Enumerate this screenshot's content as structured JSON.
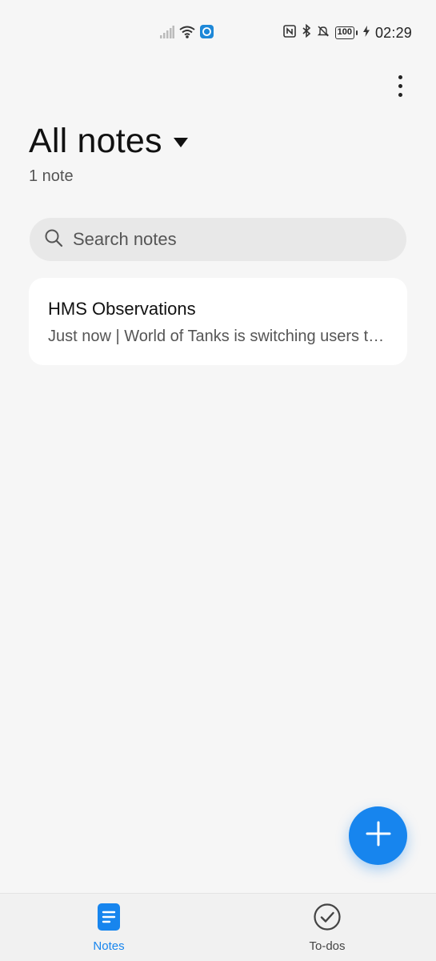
{
  "status_bar": {
    "time": "02:29",
    "battery": "100",
    "icons": [
      "signal-icon",
      "wifi-icon",
      "app-notification-icon",
      "nfc-icon",
      "bluetooth-icon",
      "mute-bell-icon",
      "battery-icon",
      "charging-icon"
    ]
  },
  "header": {
    "title": "All notes",
    "count": "1 note"
  },
  "search": {
    "placeholder": "Search notes",
    "value": ""
  },
  "notes": [
    {
      "title": "HMS Observations",
      "subtitle": "Just now | World of Tanks is switching users to HMS Core"
    }
  ],
  "bottom_nav": {
    "items": [
      {
        "label": "Notes",
        "icon": "notes-icon",
        "active": true
      },
      {
        "label": "To-dos",
        "icon": "check-circle-icon",
        "active": false
      }
    ]
  },
  "colors": {
    "accent": "#1785ee",
    "background": "#f6f6f6",
    "card": "#ffffff"
  }
}
